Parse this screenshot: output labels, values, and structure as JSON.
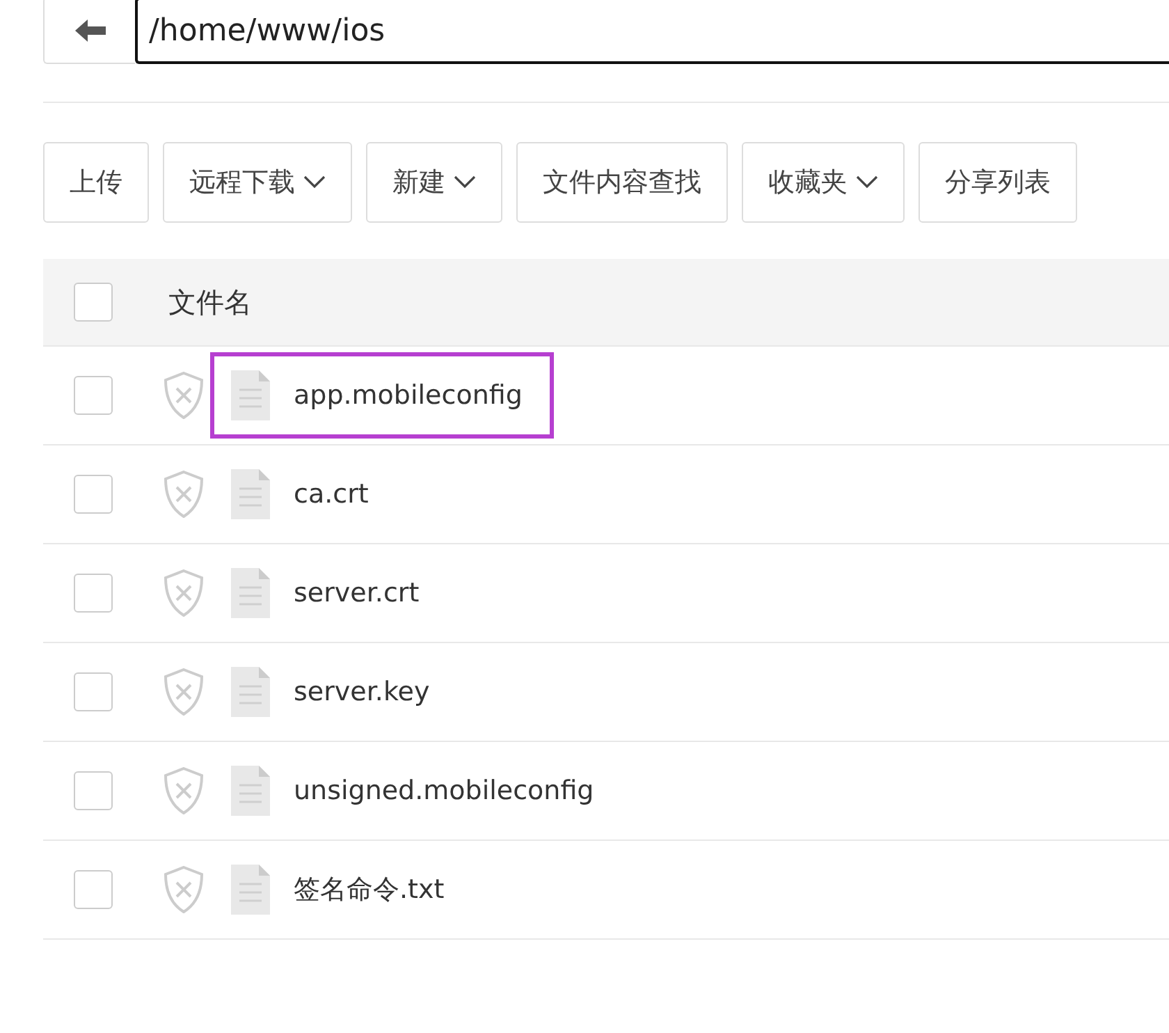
{
  "path_bar": {
    "path": "/home/www/ios"
  },
  "toolbar": [
    {
      "label": "上传",
      "dropdown": false
    },
    {
      "label": "远程下载",
      "dropdown": true
    },
    {
      "label": "新建",
      "dropdown": true
    },
    {
      "label": "文件内容查找",
      "dropdown": false
    },
    {
      "label": "收藏夹",
      "dropdown": true
    },
    {
      "label": "分享列表",
      "dropdown": false
    }
  ],
  "table": {
    "header": {
      "checked": false,
      "column": "文件名"
    },
    "rows": [
      {
        "name": "app.mobileconfig",
        "checked": false,
        "highlighted": true
      },
      {
        "name": "ca.crt",
        "checked": false,
        "highlighted": false
      },
      {
        "name": "server.crt",
        "checked": false,
        "highlighted": false
      },
      {
        "name": "server.key",
        "checked": false,
        "highlighted": false
      },
      {
        "name": "unsigned.mobileconfig",
        "checked": false,
        "highlighted": false
      },
      {
        "name": "签名命令.txt",
        "checked": false,
        "highlighted": false
      }
    ]
  }
}
